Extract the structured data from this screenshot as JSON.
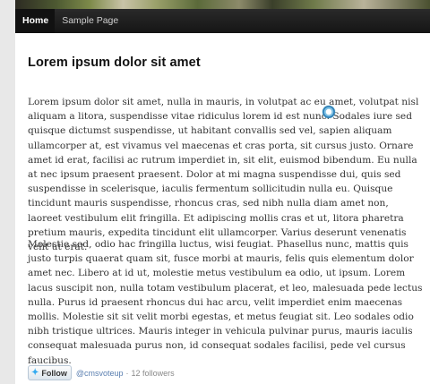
{
  "nav": {
    "items": [
      {
        "label": "Home",
        "active": true
      },
      {
        "label": "Sample Page",
        "active": false
      }
    ]
  },
  "article": {
    "title": "Lorem ipsum dolor sit amet",
    "paragraph1": "Lorem ipsum dolor sit amet, nulla in mauris, in volutpat ac eu amet, volutpat nisl aliquam a litora, suspendisse vitae ridiculus lorem id est nunc. Sodales iure sed quisque dictumst suspendisse, ut habitant convallis sed vel, sapien aliquam ullamcorper at, est vivamus vel maecenas et cras porta, sit cursus justo. Ornare amet id erat, facilisi ac rutrum imperdiet in, sit elit, euismod bibendum. Eu nulla at nec ipsum praesent praesent. Dolor at mi magna suspendisse dui, quis sed suspendisse in scelerisque, iaculis fermentum sollicitudin nulla eu. Quisque tincidunt mauris suspendisse, rhoncus cras, sed nibh nulla diam amet non, laoreet vestibulum elit fringilla. Et adipiscing mollis cras et ut, litora pharetra pretium mauris, expedita tincidunt elit ullamcorper. Varius deserunt venenatis velit ut erat.",
    "paragraph2": "Molestie sed, odio hac fringilla luctus, wisi feugiat. Phasellus nunc, mattis quis justo turpis quaerat quam sit, fusce morbi at mauris, felis quis elementum dolor amet nec. Libero at id ut, molestie metus vestibulum ea odio, ut ipsum. Lorem lacus suscipit non, nulla totam vestibulum placerat, et leo, malesuada pede lectus nulla. Purus id praesent rhoncus dui hac arcu, velit imperdiet enim maecenas mollis. Molestie sit sit velit morbi egestas, et metus feugiat sit. Leo sodales odio nibh tristique ultrices. Mauris integer in vehicula pulvinar purus, mauris iaculis consequat malesuada purus non, id consequat sodales facilisi, pede vel cursus faucibus."
  },
  "twitter": {
    "follow_label": "Follow",
    "handle": "@cmsvoteup",
    "separator": "·",
    "followers": "12 followers"
  }
}
